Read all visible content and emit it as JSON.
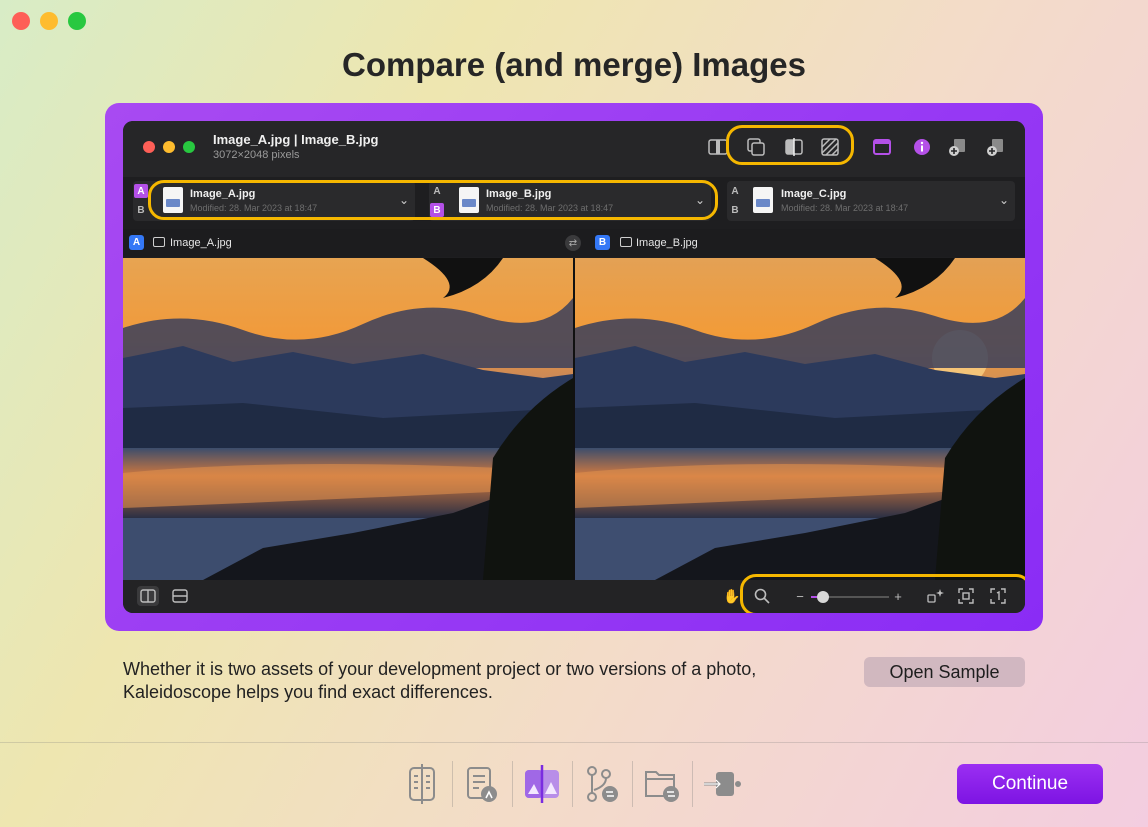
{
  "window": {
    "traffic_lights": [
      "close",
      "minimize",
      "zoom"
    ]
  },
  "title": "Compare (and merge) Images",
  "app": {
    "title": "Image_A.jpg | Image_B.jpg",
    "subtitle": "3072×2048 pixels",
    "toolbar_icons": [
      "layout-split-icon",
      "overlay-icon",
      "split-cursor-icon",
      "difference-pattern-icon",
      "window-icon",
      "info-icon",
      "add-file-a-icon",
      "add-file-b-icon"
    ],
    "accent_color": "#b450e8",
    "highlight_color": "#f5b700",
    "files": [
      {
        "slot_a": "A",
        "slot_b": "B",
        "name": "Image_A.jpg",
        "modified": "Modified: 28. Mar 2023 at 18:47",
        "active": "A"
      },
      {
        "slot_a": "A",
        "slot_b": "B",
        "name": "Image_B.jpg",
        "modified": "Modified: 28. Mar 2023 at 18:47",
        "active": "B"
      },
      {
        "slot_a": "A",
        "slot_b": "B",
        "name": "Image_C.jpg",
        "modified": "Modified: 28. Mar 2023 at 18:47",
        "active": ""
      }
    ],
    "panes": [
      {
        "badge": "A",
        "name": "Image_A.jpg"
      },
      {
        "badge": "B",
        "name": "Image_B.jpg"
      }
    ],
    "zoom": {
      "minus": "−",
      "plus": "+",
      "level": 0.15
    }
  },
  "description": "Whether it is two assets of your development project or two versions of a photo, Kaleidoscope helps you find exact differences.",
  "open_sample_label": "Open Sample",
  "continue_label": "Continue",
  "steps": [
    "text-compare-icon",
    "text-merge-icon",
    "image-compare-icon",
    "git-branch-icon",
    "folder-compare-icon",
    "integration-icon"
  ],
  "active_step": 2
}
